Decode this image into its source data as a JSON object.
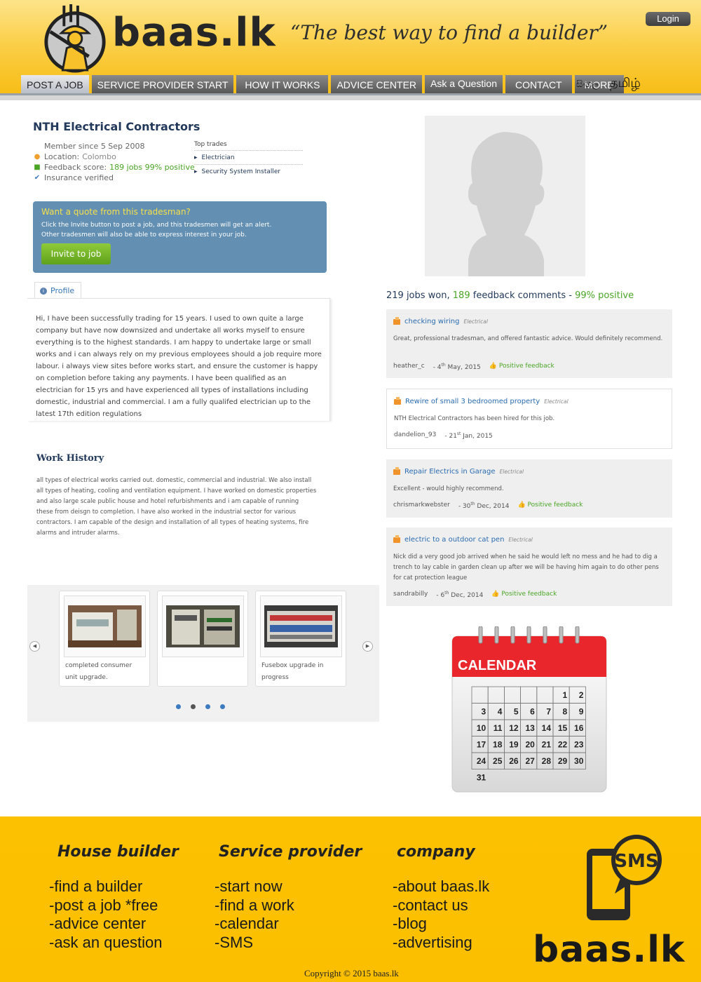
{
  "header": {
    "logo_text": "baas.lk",
    "tagline": "“The best way to find a builder”",
    "login_label": "Login",
    "nav": [
      "POST A JOB",
      "SERVICE PROVIDER START",
      "HOW IT WORKS",
      "ADVICE CENTER",
      "Ask a Question",
      "CONTACT",
      "MORE"
    ],
    "lang_sinhala": "සිංහල",
    "lang_tamil": "தமிழ்"
  },
  "profile": {
    "name": "NTH Electrical Contractors",
    "member_since": "Member since 5 Sep 2008",
    "location_label": "Location:",
    "location_value": "Colombo",
    "feedback_label": "Feedback score:",
    "feedback_value": "189 jobs 99% positive",
    "insurance": "Insurance verified",
    "top_trades_label": "Top trades",
    "top_trades": [
      "Electrician",
      "Security System Installer"
    ]
  },
  "quote": {
    "title": "Want a quote from this tradesman?",
    "line1": "Click the Invite button to post a job, and this tradesmen will get an alert.",
    "line2": "Other tradesmen will also be able to express interest in your job.",
    "button": "Invite to job"
  },
  "profile_tab": {
    "label": "Profile",
    "text": "Hi, I have been successfully trading for 15 years. I used to own quite a large company but have now downsized and undertake all works myself to ensure everything is to the highest standards. I am happy to undertake large or small works and i can always rely on my previous employees should a job require more labour. i always view sites before works start, and ensure the customer is happy on completion before taking any payments. I have been qualified as an electrician for 15 yrs and have experienced all types of installations including domestic, industrial and commercial. I am a fully qualifed electrician up to the latest 17th edition regulations"
  },
  "work_history": {
    "title": "Work History",
    "text": "all types of electrical works carried out. domestic, commercial and industrial. We also install all types of heating, cooling and ventilation equipment. I have worked on domestic properties and also large scale public house and hotel refurbishments and i am capable of running these from deisgn to completion. I have also worked in the industrial sector for various contractors. I am capable of the design and installation of all types of heating systems, fire alarms and intruder alarms."
  },
  "gallery": {
    "captions": [
      "completed consumer unit upgrade.",
      "",
      "Fusebox upgrade in progress"
    ],
    "prev_icon": "chevron-left-icon",
    "next_icon": "chevron-right-icon"
  },
  "stats": {
    "jobs_won": "219 jobs won,",
    "comments_num": "189",
    "comments_label": "feedback comments -",
    "positive": "99% positive"
  },
  "feedback": [
    {
      "title": "checking wiring",
      "category": "Electrical",
      "text": "Great, professional tradesman, and offered fantastic advice. Would definitely recommend.",
      "user": "heather_c",
      "date_pre": "- 4",
      "date_sup": "th",
      "date_post": " May, 2015",
      "rating": "Positive feedback"
    },
    {
      "title": "Rewire of small 3 bedroomed property",
      "category": "Electrical",
      "text": "NTH Electrical Contractors has been hired for this job.",
      "user": "dandelion_93",
      "date_pre": "- 21",
      "date_sup": "st",
      "date_post": " Jan, 2015",
      "rating": ""
    },
    {
      "title": "Repair Electrics in Garage",
      "category": "Electrical",
      "text": "Excellent - would highly recommend.",
      "user": "chrismarkwebster",
      "date_pre": "- 30",
      "date_sup": "th",
      "date_post": " Dec, 2014",
      "rating": "Positive feedback"
    },
    {
      "title": "electric to a outdoor cat pen",
      "category": "Electrical",
      "text": "Nick did a very good job arrived when he said he would left no mess and he had to dig a trench to lay cable in garden clean up after we will be having him again to do other pens for cat protection league",
      "user": "sandrabilly",
      "date_pre": "- 6",
      "date_sup": "th",
      "date_post": " Dec, 2014",
      "rating": "Positive feedback"
    }
  ],
  "calendar": {
    "title": "CALENDAR",
    "days": [
      "1",
      "2",
      "3",
      "4",
      "5",
      "6",
      "7",
      "8",
      "9",
      "10",
      "11",
      "12",
      "13",
      "14",
      "15",
      "16",
      "17",
      "18",
      "19",
      "20",
      "21",
      "22",
      "23",
      "24",
      "25",
      "26",
      "27",
      "28",
      "29",
      "30",
      "31"
    ]
  },
  "footer": {
    "col1_title": "House builder",
    "col1": [
      "-find a builder",
      "-post a job *free",
      "-advice center",
      "-ask an question"
    ],
    "col2_title": "Service provider",
    "col2": [
      "-start now",
      "-find a work",
      "-calendar",
      "-SMS"
    ],
    "col3_title": "company",
    "col3": [
      "-about baas.lk",
      "-contact us",
      "-blog",
      "-advertising"
    ],
    "sms_label": "SMS",
    "logo_text": "baas.lk",
    "copyright": "Copyright © 2015 baas.lk"
  },
  "colors": {
    "header_yellow": "#fbcf4a",
    "footer_yellow": "#fcc100",
    "navy": "#23395b",
    "green": "#4aa526",
    "link_blue": "#2a6bb0",
    "quote_blue": "#628fb2"
  }
}
